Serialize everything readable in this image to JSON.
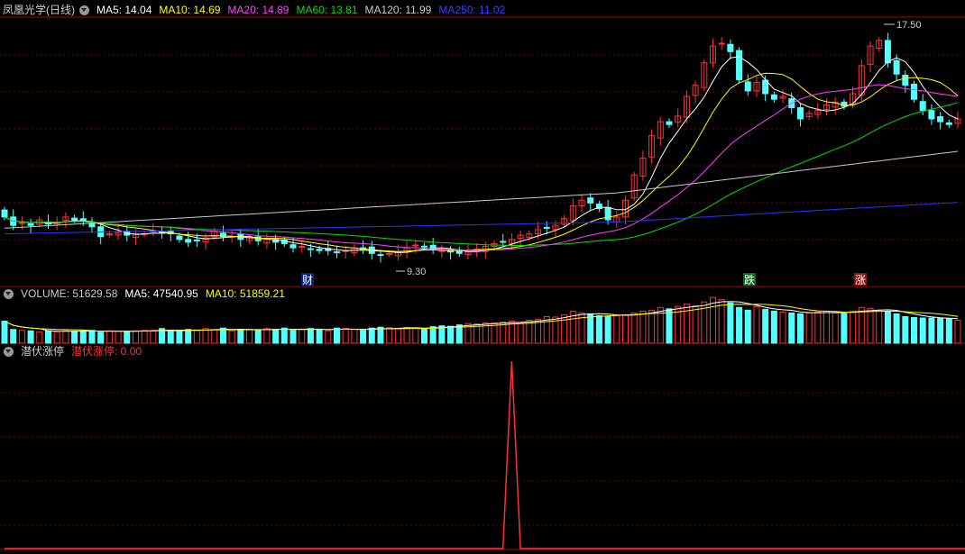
{
  "header": {
    "stock_name": "凤凰光学(日线)",
    "ma5": "MA5: 14.04",
    "ma10": "MA10: 14.69",
    "ma20": "MA20: 14.89",
    "ma60": "MA60: 13.81",
    "ma120": "MA120: 11.99",
    "ma250": "MA250: 11.02"
  },
  "volume_header": {
    "title": "VOLUME: 51629.58",
    "ma5": "MA5: 47540.95",
    "ma10": "MA10: 51859.21"
  },
  "indicator_header": {
    "title": "潜伏涨停",
    "value_label": "潜伏涨停: 0.00"
  },
  "markers": {
    "high_label": "17.50",
    "low_label": "9.30",
    "fin_marker": "财",
    "fall_marker": "跌",
    "rise_marker": "涨"
  },
  "colors": {
    "up": "#ff3232",
    "down": "#54ffff",
    "ma5": "#ffffff",
    "ma10": "#ffff00",
    "ma20": "#ff40ff",
    "ma60": "#00e000",
    "ma120": "#c8c8c8",
    "ma250": "#3030ff",
    "grid": "#7a0000"
  },
  "chart_data": [
    {
      "type": "candlestick",
      "title": "凤凰光学(日线)",
      "price_range": [
        9.0,
        18.0
      ],
      "closes": [
        10.9,
        10.6,
        10.7,
        10.6,
        10.8,
        10.65,
        10.7,
        10.9,
        10.8,
        10.75,
        10.55,
        10.2,
        10.3,
        10.35,
        10.25,
        10.3,
        10.3,
        10.4,
        10.35,
        10.3,
        10.1,
        10.0,
        10.05,
        10.15,
        10.4,
        10.2,
        10.2,
        10.1,
        10.15,
        10.05,
        10.1,
        10.0,
        9.95,
        9.8,
        9.85,
        9.75,
        9.7,
        9.7,
        9.65,
        9.7,
        9.8,
        9.75,
        9.6,
        9.55,
        9.6,
        9.65,
        9.8,
        9.9,
        9.85,
        9.75,
        9.7,
        9.65,
        9.6,
        9.65,
        9.75,
        9.85,
        9.95,
        10.0,
        10.1,
        10.25,
        10.3,
        10.45,
        10.5,
        10.6,
        10.85,
        11.3,
        11.5,
        11.4,
        11.2,
        10.8,
        10.9,
        11.5,
        12.4,
        13.0,
        13.8,
        14.3,
        14.2,
        14.5,
        15.2,
        15.6,
        16.4,
        17.0,
        17.1,
        16.8,
        15.8,
        15.4,
        15.7,
        15.3,
        15.1,
        15.2,
        14.8,
        14.4,
        14.6,
        14.7,
        14.9,
        15.0,
        14.85,
        15.3,
        16.3,
        17.0,
        17.2,
        16.4,
        16.0,
        15.6,
        15.1,
        14.7,
        14.4,
        14.3,
        14.2,
        14.4
      ]
    },
    {
      "type": "bar",
      "title": "VOLUME",
      "values": [
        48,
        30,
        28,
        27,
        25,
        27,
        25,
        27,
        26,
        27,
        28,
        24,
        27,
        26,
        26,
        27,
        28,
        28,
        32,
        27,
        26,
        30,
        28,
        32,
        30,
        33,
        27,
        30,
        30,
        28,
        32,
        30,
        33,
        28,
        30,
        32,
        30,
        27,
        33,
        32,
        30,
        28,
        33,
        35,
        34,
        32,
        34,
        33,
        32,
        36,
        38,
        37,
        40,
        43,
        42,
        44,
        44,
        46,
        48,
        45,
        50,
        52,
        58,
        57,
        62,
        70,
        66,
        64,
        60,
        58,
        60,
        62,
        66,
        70,
        72,
        78,
        75,
        80,
        85,
        82,
        90,
        100,
        95,
        88,
        78,
        72,
        80,
        74,
        70,
        68,
        66,
        64,
        66,
        68,
        70,
        66,
        65,
        70,
        78,
        76,
        72,
        68,
        64,
        58,
        56,
        55,
        55,
        54,
        53,
        50
      ]
    },
    {
      "type": "line",
      "title": "潜伏涨停",
      "values": [
        0,
        0,
        0,
        0,
        0,
        0,
        0,
        0,
        0,
        0,
        0,
        0,
        0,
        0,
        0,
        0,
        0,
        0,
        0,
        0,
        0,
        0,
        0,
        0,
        0,
        0,
        0,
        0,
        0,
        0,
        0,
        0,
        0,
        0,
        0,
        0,
        0,
        0,
        0,
        0,
        0,
        0,
        0,
        0,
        0,
        0,
        0,
        0,
        0,
        0,
        0,
        0,
        0,
        0,
        0,
        0,
        0,
        0,
        1,
        0,
        0,
        0,
        0,
        0,
        0,
        0,
        0,
        0,
        0,
        0,
        0,
        0,
        0,
        0,
        0,
        0,
        0,
        0,
        0,
        0,
        0,
        0,
        0,
        0,
        0,
        0,
        0,
        0,
        0,
        0,
        0,
        0,
        0,
        0,
        0,
        0,
        0,
        0,
        0,
        0,
        0,
        0,
        0,
        0,
        0,
        0,
        0,
        0,
        0,
        0,
        0,
        0
      ]
    }
  ]
}
